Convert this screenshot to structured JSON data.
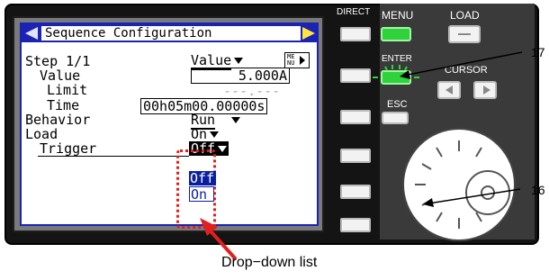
{
  "screen": {
    "title": "Sequence Configuration",
    "rows": {
      "step": "Step 1/1",
      "value_label": "Value",
      "limit_label": "Limit",
      "time_label": "Time",
      "behavior_label": "Behavior",
      "load_label": "Load",
      "trigger_label": "Trigger"
    },
    "field_mode": "Value",
    "menu_tag_top": "ME",
    "menu_tag_bottom": "NU",
    "value": "5.000A",
    "limit": "---.---",
    "time": "00h05m00.00000s",
    "behavior": "Run",
    "load": "On",
    "trigger_selected": "Off"
  },
  "dropdown": {
    "options": [
      "Off",
      "On"
    ],
    "highlighted": "Off"
  },
  "panel": {
    "direct": "DIRECT",
    "menu": "MENU",
    "load": "LOAD",
    "enter": "ENTER",
    "cursor": "CURSOR",
    "esc": "ESC"
  },
  "callouts": {
    "enter_ref": "17",
    "knob_ref": "16",
    "caption": "Drop−down list"
  },
  "colors": {
    "lcd_frame": "#1a23b4",
    "highlight": "#0a1fa0",
    "menu_led": "#2fd23a",
    "dropdown_marker": "#e0201e",
    "title_arrow_right": "#ffe63c"
  }
}
